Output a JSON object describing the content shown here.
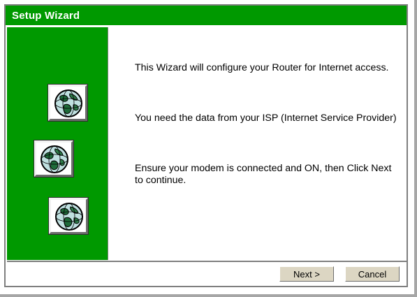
{
  "window": {
    "title": "Setup Wizard"
  },
  "sidebar": {
    "globe_icons": [
      "globe-icon",
      "globe-icon",
      "globe-icon"
    ]
  },
  "content": {
    "message_1": "This Wizard will configure your Router for Internet access.",
    "message_2": "You need the data from your ISP (Internet Service Provider)",
    "message_3": "Ensure your modem is connected and ON, then Click Next to continue."
  },
  "footer": {
    "next_label": "Next >",
    "cancel_label": "Cancel"
  },
  "colors": {
    "title_bar": "#009900",
    "sidebar": "#009900",
    "button_face": "#dcd6c3",
    "window_bg": "#c0c0c0"
  }
}
